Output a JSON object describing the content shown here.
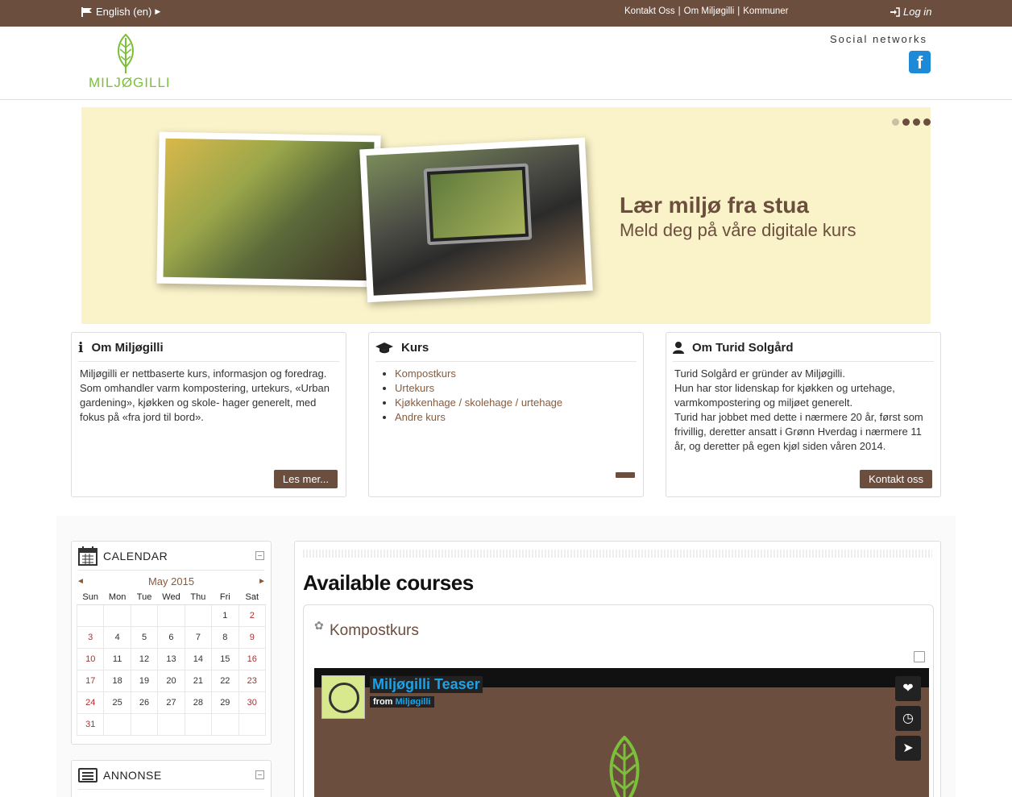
{
  "topbar": {
    "language": "English (en)",
    "links": [
      "Kontakt Oss",
      "Om Miljøgilli",
      "Kommuner"
    ],
    "login": "Log in"
  },
  "header": {
    "logo_text": "MILJØGILLI",
    "social_label": "Social networks",
    "facebook_icon": "facebook-icon"
  },
  "banner": {
    "title": "Lær miljø fra stua",
    "subtitle": "Meld deg på våre digitale kurs",
    "slide_count": 4,
    "active_slide": 2
  },
  "boxes": [
    {
      "title": "Om Miljøgilli",
      "icon": "info-icon",
      "text": " Miljøgilli er nettbaserte kurs, informasjon og foredrag. Som omhandler varm kompostering, urtekurs, «Urban gardening», kjøkken og skole- hager generelt, med fokus på  «fra jord til bord».",
      "button": "Les mer..."
    },
    {
      "title": "Kurs",
      "icon": "graduation-cap-icon",
      "links": [
        "Kompostkurs",
        "Urtekurs",
        "Kjøkkenhage / skolehage / urtehage",
        "Andre kurs"
      ]
    },
    {
      "title": "Om Turid Solgård",
      "icon": "user-icon",
      "text1": "Turid Solgård er gründer av Miljøgilli.",
      "text2": "Hun har stor lidenskap for kjøkken og urtehage, varmkompostering og miljøet generelt.",
      "text3": "Turid har jobbet med dette i nærmere 20 år, først som frivillig, deretter ansatt i Grønn Hverdag i nærmere 11 år, og deretter på egen kjøl siden våren 2014.",
      "button": "Kontakt oss"
    }
  ],
  "calendar": {
    "title": "CALENDAR",
    "month": "May 2015",
    "prev": "◄",
    "next": "►",
    "weekdays": [
      "Sun",
      "Mon",
      "Tue",
      "Wed",
      "Thu",
      "Fri",
      "Sat"
    ],
    "weeks": [
      [
        "",
        "",
        "",
        "",
        "",
        "1",
        "2"
      ],
      [
        "3",
        "4",
        "5",
        "6",
        "7",
        "8",
        "9"
      ],
      [
        "10",
        "11",
        "12",
        "13",
        "14",
        "15",
        "16"
      ],
      [
        "17",
        "18",
        "19",
        "20",
        "21",
        "22",
        "23"
      ],
      [
        "24",
        "25",
        "26",
        "27",
        "28",
        "29",
        "30"
      ],
      [
        "31",
        "",
        "",
        "",
        "",
        "",
        ""
      ]
    ]
  },
  "annonse": {
    "title": "ANNONSE"
  },
  "main": {
    "heading": "Available courses",
    "course": {
      "title": "Kompostkurs",
      "video": {
        "title": "Miljøgilli Teaser",
        "from_label": "from",
        "from_name": "Miljøgilli",
        "buttons": [
          "heart-icon",
          "clock-icon",
          "send-icon"
        ]
      }
    }
  },
  "colors": {
    "brand_brown": "#6b4e3d",
    "banner_bg": "#faf2c8",
    "logo_green": "#7bbf3a",
    "facebook_blue": "#1c8ad6",
    "vimeo_blue": "#1aa3e8"
  }
}
